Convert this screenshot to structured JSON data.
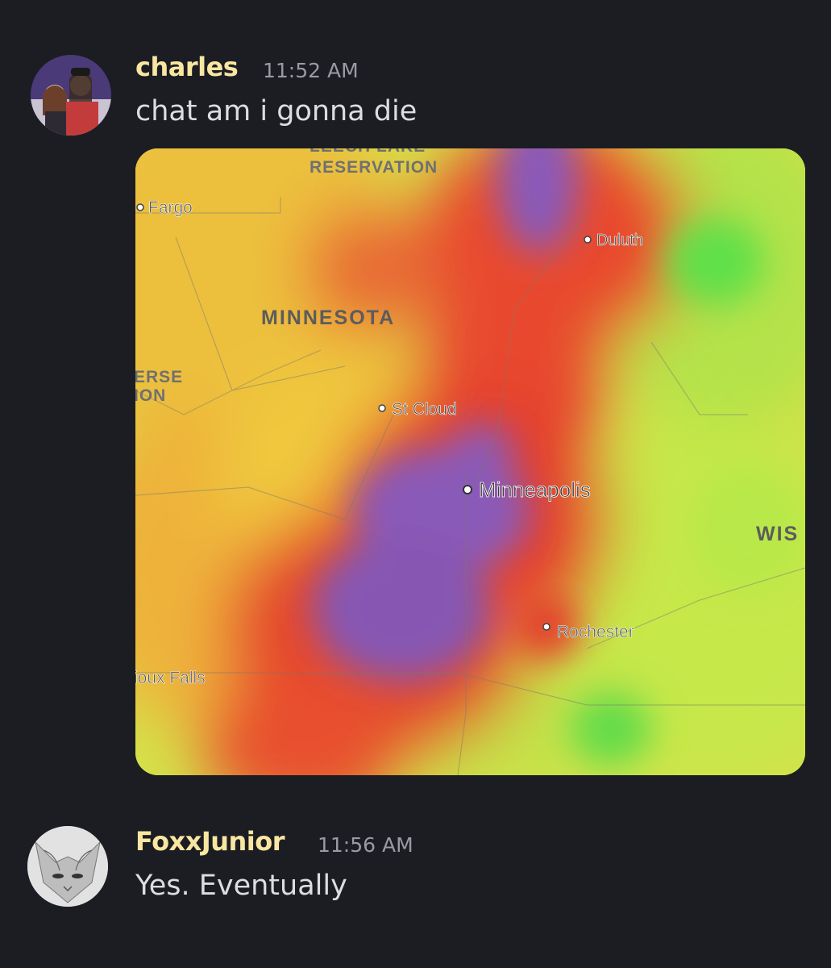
{
  "messages": [
    {
      "username": "charles",
      "timestamp": "11:52 AM",
      "content": "chat am i gonna die",
      "username_color": "#f8e6a1"
    },
    {
      "username": "FoxxJunior",
      "timestamp": "11:56 AM",
      "content": "Yes. Eventually",
      "username_color": "#f8e6a1"
    }
  ],
  "map": {
    "labels": {
      "reservation_top": "LEECH LAKE",
      "reservation_bottom": "RESERVATION",
      "fargo": "Fargo",
      "duluth": "Duluth",
      "minnesota": "MINNESOTA",
      "traverse_1": "ERSE",
      "traverse_2": "ION",
      "st_cloud": "St Cloud",
      "minneapolis": "Minneapolis",
      "wisconsin": "WIS",
      "rochester": "Rochester",
      "sioux_falls": "ioux Falls"
    }
  },
  "colors": {
    "background": "#1c1d23",
    "text": "#dcdde2",
    "muted": "#9a9ba2"
  }
}
